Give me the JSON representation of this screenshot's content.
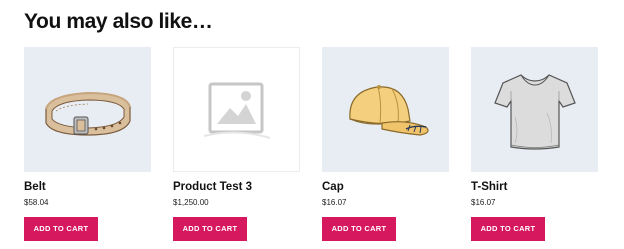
{
  "section": {
    "title": "You may also like…"
  },
  "products": [
    {
      "name": "Belt",
      "price": "$58.04",
      "button_label": "ADD TO CART",
      "image_icon": "belt-image"
    },
    {
      "name": "Product Test 3",
      "price": "$1,250.00",
      "button_label": "ADD TO CART",
      "image_icon": "placeholder-image-icon"
    },
    {
      "name": "Cap",
      "price": "$16.07",
      "button_label": "ADD TO CART",
      "image_icon": "cap-image"
    },
    {
      "name": "T-Shirt",
      "price": "$16.07",
      "button_label": "ADD TO CART",
      "image_icon": "tshirt-image"
    }
  ],
  "colors": {
    "accent": "#d6185f",
    "image_background": "#e8edf3",
    "text": "#111111"
  }
}
